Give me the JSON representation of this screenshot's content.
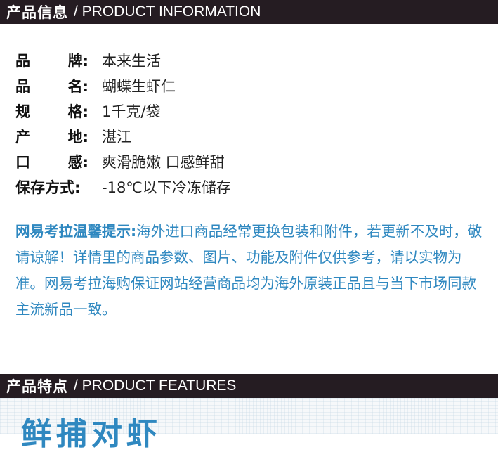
{
  "product_info": {
    "heading_cn": "产品信息",
    "heading_en": "/ PRODUCT INFORMATION",
    "rows": [
      {
        "label_a": "品",
        "label_b": "牌:",
        "value": "本来生活"
      },
      {
        "label_a": "品",
        "label_b": "名:",
        "value": "蝴蝶生虾仁"
      },
      {
        "label_a": "规",
        "label_b": "格:",
        "value": "1千克/袋"
      },
      {
        "label_a": "产",
        "label_b": "地:",
        "value": "湛江"
      },
      {
        "label_a": "口",
        "label_b": "感:",
        "value": "爽滑脆嫩 口感鲜甜"
      },
      {
        "label_full": "保存方式:",
        "value": "-18℃以下冷冻储存"
      }
    ]
  },
  "notice": {
    "title": "网易考拉温馨提示:",
    "text": "海外进口商品经常更换包装和附件，若更新不及时，敬请谅解！详情里的商品参数、图片、功能及附件仅供参考，请以实物为准。网易考拉海购保证网站经营商品均为海外原装正品且与当下市场同款主流新品一致。"
  },
  "product_features": {
    "heading_cn": "产品特点",
    "heading_en": "/ PRODUCT FEATURES",
    "feature_title": "鲜捕对虾"
  },
  "colors": {
    "bar_bg": "#251c22",
    "notice_blue": "#2f88c0"
  }
}
